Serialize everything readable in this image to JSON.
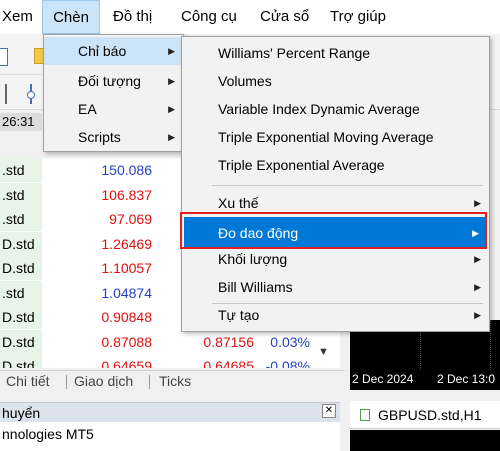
{
  "menubar": {
    "items": [
      {
        "label": "Xem"
      },
      {
        "label": "Chèn"
      },
      {
        "label": "Đồ thị"
      },
      {
        "label": "Công cụ"
      },
      {
        "label": "Cửa sổ"
      },
      {
        "label": "Trợ giúp"
      }
    ]
  },
  "clock": "26:31",
  "insert_menu": {
    "items": [
      "Chỉ báo",
      "Đối tượng",
      "EA",
      "Scripts"
    ]
  },
  "indicator_menu": {
    "items": [
      "Williams' Percent Range",
      "Volumes",
      "Variable Index Dynamic Average",
      "Triple Exponential Moving Average",
      "Triple Exponential Average",
      "Xu thế",
      "Đo dao động",
      "Khối lượng",
      "Bill Williams",
      "Tự tạo"
    ]
  },
  "market_watch": {
    "rows": [
      {
        "symbol": ".std",
        "bid": "150.086",
        "ask": "",
        "change": ""
      },
      {
        "symbol": ".std",
        "bid": "106.837",
        "ask": "",
        "change": ""
      },
      {
        "symbol": ".std",
        "bid": "97.069",
        "ask": "",
        "change": ""
      },
      {
        "symbol": "D.std",
        "bid": "1.26469",
        "ask": "",
        "change": ""
      },
      {
        "symbol": "D.std",
        "bid": "1.10057",
        "ask": "",
        "change": ""
      },
      {
        "symbol": ".std",
        "bid": "1.04874",
        "ask": "",
        "change": ""
      },
      {
        "symbol": "D.std",
        "bid": "0.90848",
        "ask": "",
        "change": ""
      },
      {
        "symbol": "D.std",
        "bid": "0.87088",
        "ask": "0.87156",
        "change": "0.03%"
      },
      {
        "symbol": "D.std",
        "bid": "0.64659",
        "ask": "0.64685",
        "change": "-0.08%"
      }
    ],
    "colors": {
      "up": "#2840c8",
      "down": "#e01010"
    }
  },
  "tabs": [
    "Chi tiết",
    "Giao dịch",
    "Ticks"
  ],
  "navigator": {
    "title": "huyển",
    "item": "nnologies MT5"
  },
  "charts": {
    "axis_labels": [
      "2 Dec 2024",
      "2 Dec 13:0"
    ],
    "chart2_title": "GBPUSD.std,H1"
  },
  "accent": "#0078d7"
}
